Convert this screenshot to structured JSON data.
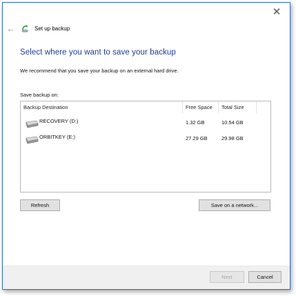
{
  "window": {
    "title": "Set up backup",
    "close_glyph": "✕",
    "back_glyph": "←"
  },
  "main": {
    "heading": "Select where you want to save your backup",
    "recommendation": "We recommend that you save your backup on an external hard drive.",
    "save_on_label": "Save backup on:"
  },
  "table": {
    "headers": {
      "destination": "Backup Destination",
      "free_space": "Free Space",
      "total_size": "Total Size"
    },
    "rows": [
      {
        "name": "RECOVERY (D:)",
        "free": "1.32 GB",
        "total": "10.54 GB",
        "icon": "drive-icon"
      },
      {
        "name": "ORBITKEY (E:)",
        "free": "27.29 GB",
        "total": "29.98 GB",
        "icon": "drive-icon"
      }
    ]
  },
  "buttons": {
    "refresh": "Refresh",
    "save_network": "Save on a network...",
    "next": "Next",
    "cancel": "Cancel"
  },
  "colors": {
    "heading": "#1e3c9b",
    "window_border": "#2b6dc9",
    "footer": "#f0f0f0"
  }
}
